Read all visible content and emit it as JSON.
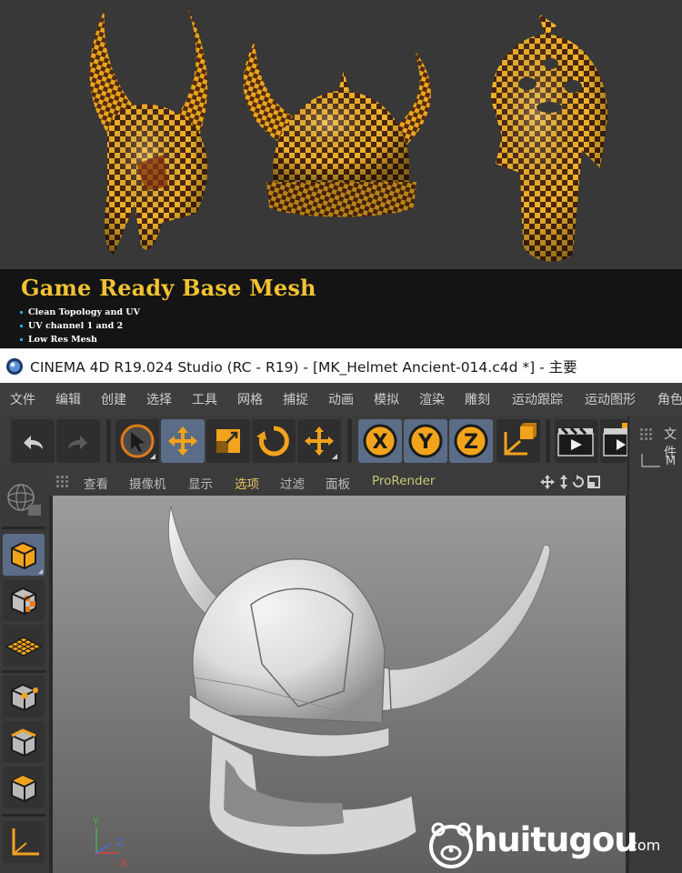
{
  "banner": {
    "title": "Game Ready Base Mesh",
    "features": [
      "Clean Topology and UV",
      "UV channel 1 and 2",
      "Low Res Mesh"
    ]
  },
  "window": {
    "title": "CINEMA 4D R19.024 Studio (RC - R19) - [MK_Helmet Ancient-014.c4d *] - 主要"
  },
  "menu": [
    "文件",
    "编辑",
    "创建",
    "选择",
    "工具",
    "网格",
    "捕捉",
    "动画",
    "模拟",
    "渲染",
    "雕刻",
    "运动跟踪",
    "运动图形",
    "角色"
  ],
  "toolbar": {
    "buttons": [
      "undo-icon",
      "redo-icon",
      "live-select-icon",
      "move-icon",
      "scale-icon",
      "rotate-icon",
      "create-icon",
      "x-axis-icon",
      "y-axis-icon",
      "z-axis-icon",
      "coordinate-system-icon",
      "render-view-icon",
      "render-picture-icon"
    ],
    "axis_labels": [
      "X",
      "Y",
      "Z"
    ]
  },
  "left_tools": [
    "make-editable-icon",
    "model-mode-icon",
    "texture-mode-icon",
    "workplane-icon",
    "points-mode-icon",
    "edges-mode-icon",
    "polygons-mode-icon",
    "axis-mode-icon"
  ],
  "viewport_menu": [
    "查看",
    "摄像机",
    "显示",
    "选项",
    "过滤",
    "面板",
    "ProRender"
  ],
  "right_panel": {
    "tab": "文件",
    "item": "M"
  },
  "viewport_axes": [
    "Y",
    "Z",
    "X"
  ],
  "watermark": {
    "brand": "huitugou",
    "suffix": ".com"
  },
  "colors": {
    "accent": "#f2c233",
    "selected": "#5b6c86",
    "checker_gold": "#e8a51c",
    "checker_dark": "#4a2510"
  }
}
